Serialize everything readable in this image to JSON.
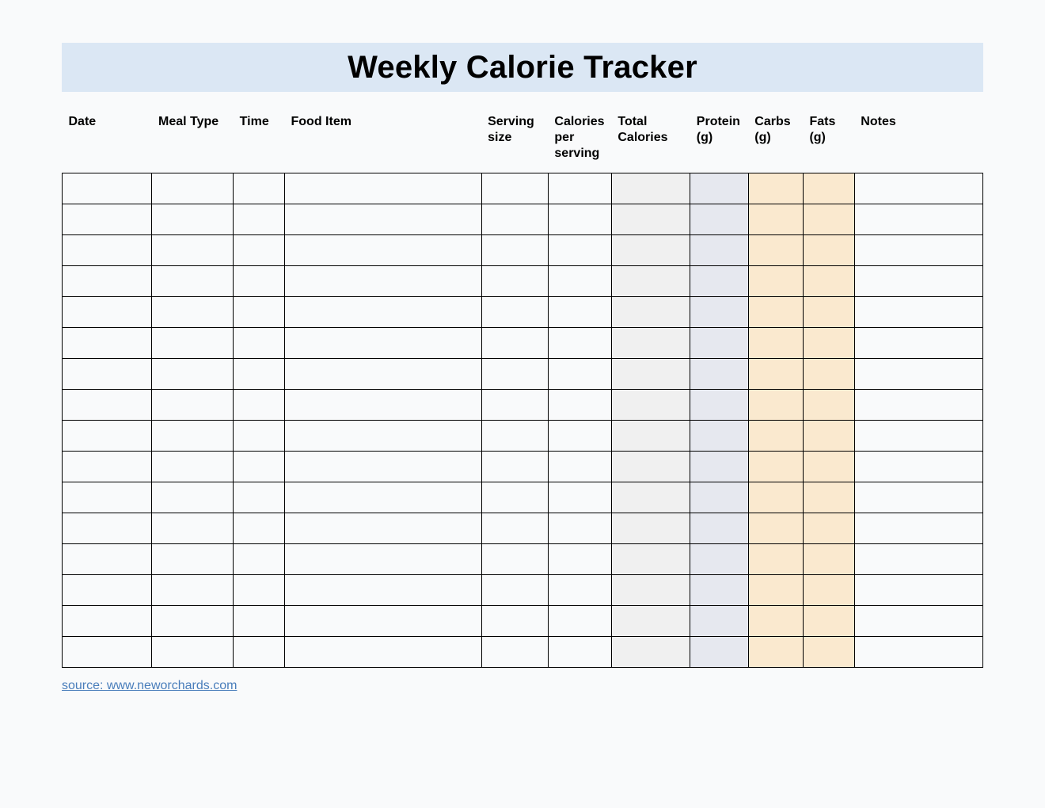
{
  "title": "Weekly Calorie Tracker",
  "columns": [
    "Date",
    "Meal Type",
    "Time",
    "Food Item",
    "Serving size",
    "Calories per serving",
    "Total Calories",
    "Protein (g)",
    "Carbs (g)",
    "Fats (g)",
    "Notes"
  ],
  "row_count": 16,
  "source_label": "source: www.neworchards.com",
  "colors": {
    "title_band": "#dbe7f4",
    "col_total_calories": "#f0f0f0",
    "col_protein": "#e6e8ef",
    "col_carbs": "#fae9cf",
    "col_fats": "#fae9cf"
  }
}
